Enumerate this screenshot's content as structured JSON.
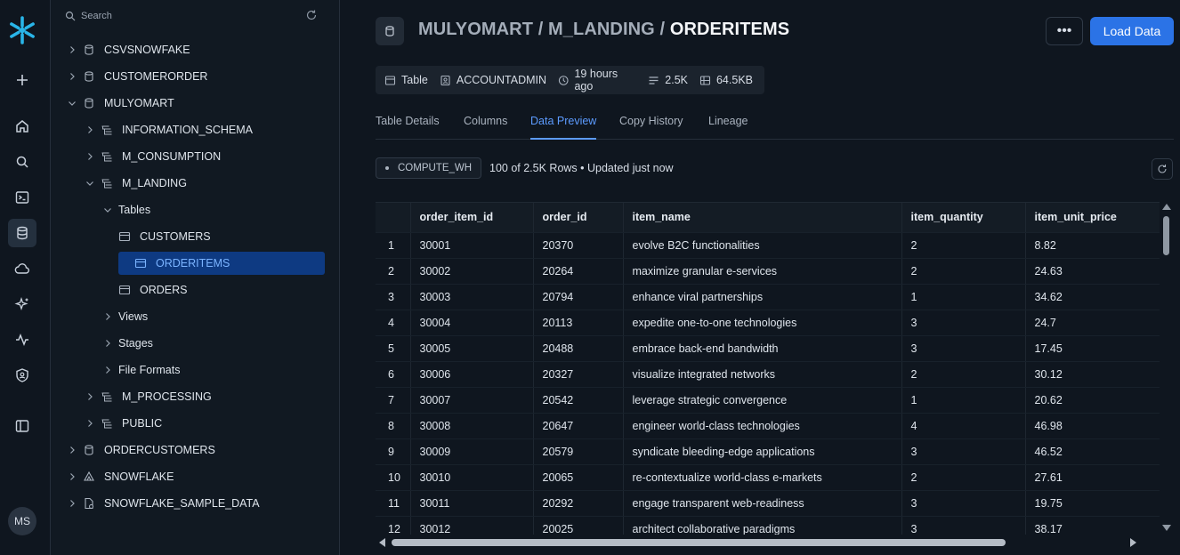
{
  "search": {
    "placeholder": "Search"
  },
  "tree": {
    "items": [
      {
        "label": "CSVSNOWFAKE",
        "kind": "database",
        "level": 0,
        "expanded": false
      },
      {
        "label": "CUSTOMERORDER",
        "kind": "database",
        "level": 0,
        "expanded": false
      },
      {
        "label": "MULYOMART",
        "kind": "database",
        "level": 0,
        "expanded": true
      },
      {
        "label": "INFORMATION_SCHEMA",
        "kind": "schema",
        "level": 1,
        "expanded": false
      },
      {
        "label": "M_CONSUMPTION",
        "kind": "schema",
        "level": 1,
        "expanded": false
      },
      {
        "label": "M_LANDING",
        "kind": "schema",
        "level": 1,
        "expanded": true
      },
      {
        "label": "Tables",
        "kind": "folder",
        "level": 2,
        "expanded": true
      },
      {
        "label": "CUSTOMERS",
        "kind": "table",
        "level": 3
      },
      {
        "label": "ORDERITEMS",
        "kind": "table",
        "level": 3,
        "selected": true
      },
      {
        "label": "ORDERS",
        "kind": "table",
        "level": 3
      },
      {
        "label": "Views",
        "kind": "folder",
        "level": 2,
        "expanded": false
      },
      {
        "label": "Stages",
        "kind": "folder",
        "level": 2,
        "expanded": false
      },
      {
        "label": "File Formats",
        "kind": "folder",
        "level": 2,
        "expanded": false
      },
      {
        "label": "M_PROCESSING",
        "kind": "schema",
        "level": 1,
        "expanded": false
      },
      {
        "label": "PUBLIC",
        "kind": "schema",
        "level": 1,
        "expanded": false
      },
      {
        "label": "ORDERCUSTOMERS",
        "kind": "database",
        "level": 0,
        "expanded": false
      },
      {
        "label": "SNOWFLAKE",
        "kind": "shared-database",
        "level": 0,
        "expanded": false
      },
      {
        "label": "SNOWFLAKE_SAMPLE_DATA",
        "kind": "shared-data",
        "level": 0,
        "expanded": false
      }
    ]
  },
  "user": {
    "initials": "MS"
  },
  "header": {
    "breadcrumb_db": "MULYOMART",
    "sep1": " / ",
    "breadcrumb_schema": "M_LANDING",
    "sep2": " / ",
    "breadcrumb_object": "ORDERITEMS",
    "more_label": "•••",
    "load_label": "Load Data"
  },
  "meta": {
    "type": "Table",
    "owner": "ACCOUNTADMIN",
    "modified": "19 hours ago",
    "rows": "2.5K",
    "size": "64.5KB"
  },
  "tabs": [
    "Table Details",
    "Columns",
    "Data Preview",
    "Copy History",
    "Lineage"
  ],
  "active_tab": "Data Preview",
  "preview": {
    "warehouse": "COMPUTE_WH",
    "row_info": "100 of 2.5K Rows • Updated just now",
    "columns": [
      "",
      "order_item_id",
      "order_id",
      "item_name",
      "item_quantity",
      "item_unit_price"
    ],
    "rows": [
      [
        "1",
        "30001",
        "20370",
        "evolve B2C functionalities",
        "2",
        "8.82"
      ],
      [
        "2",
        "30002",
        "20264",
        "maximize granular e-services",
        "2",
        "24.63"
      ],
      [
        "3",
        "30003",
        "20794",
        "enhance viral partnerships",
        "1",
        "34.62"
      ],
      [
        "4",
        "30004",
        "20113",
        "expedite one-to-one technologies",
        "3",
        "24.7"
      ],
      [
        "5",
        "30005",
        "20488",
        "embrace back-end bandwidth",
        "3",
        "17.45"
      ],
      [
        "6",
        "30006",
        "20327",
        "visualize integrated networks",
        "2",
        "30.12"
      ],
      [
        "7",
        "30007",
        "20542",
        "leverage strategic convergence",
        "1",
        "20.62"
      ],
      [
        "8",
        "30008",
        "20647",
        "engineer world-class technologies",
        "4",
        "46.98"
      ],
      [
        "9",
        "30009",
        "20579",
        "syndicate bleeding-edge applications",
        "3",
        "46.52"
      ],
      [
        "10",
        "30010",
        "20065",
        "re-contextualize world-class e-markets",
        "2",
        "27.61"
      ],
      [
        "11",
        "30011",
        "20292",
        "engage transparent web-readiness",
        "3",
        "19.75"
      ],
      [
        "12",
        "30012",
        "20025",
        "architect collaborative paradigms",
        "3",
        "38.17"
      ]
    ]
  },
  "colors": {
    "accent": "#2b73e6",
    "selected_bg": "#0e3a82",
    "logo": "#29b5e8"
  }
}
